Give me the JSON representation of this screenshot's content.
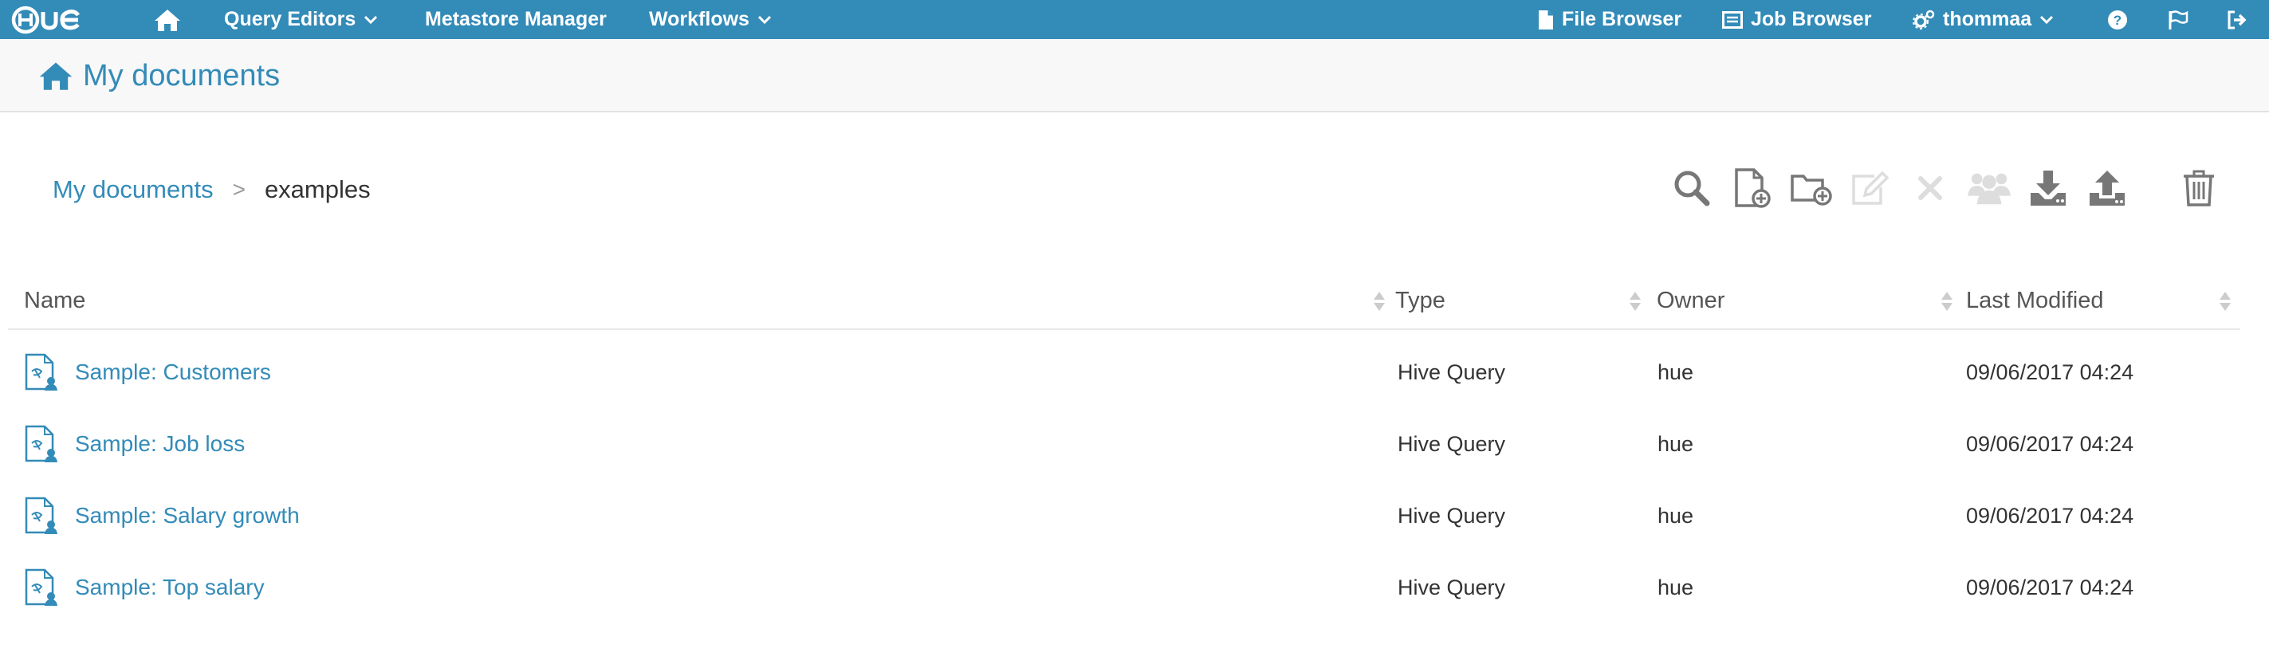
{
  "topnav": {
    "logo_text": "HUE",
    "home_icon": "home-icon",
    "query_editors": "Query Editors",
    "metastore": "Metastore Manager",
    "workflows": "Workflows",
    "file_browser": "File Browser",
    "job_browser": "Job Browser",
    "user": "thommaa",
    "help_icon": "help-icon",
    "flag_icon": "flag-icon",
    "logout_icon": "logout-icon"
  },
  "header": {
    "title": "My documents"
  },
  "breadcrumb": {
    "root": "My documents",
    "separator": ">",
    "current": "examples"
  },
  "toolbar": {
    "search_icon": "search-icon",
    "new_document_icon": "new-document-icon",
    "new_folder_icon": "new-folder-icon",
    "rename_icon": "edit-icon",
    "remove_icon": "x-icon",
    "share_icon": "users-icon",
    "download_icon": "download-icon",
    "upload_icon": "upload-icon",
    "trash_icon": "trash-icon"
  },
  "table": {
    "columns": [
      "Name",
      "Type",
      "Owner",
      "Last Modified"
    ],
    "rows": [
      {
        "name": "Sample: Customers",
        "type": "Hive Query",
        "owner": "hue",
        "modified": "09/06/2017 04:24"
      },
      {
        "name": "Sample: Job loss",
        "type": "Hive Query",
        "owner": "hue",
        "modified": "09/06/2017 04:24"
      },
      {
        "name": "Sample: Salary growth",
        "type": "Hive Query",
        "owner": "hue",
        "modified": "09/06/2017 04:24"
      },
      {
        "name": "Sample: Top salary",
        "type": "Hive Query",
        "owner": "hue",
        "modified": "09/06/2017 04:24"
      }
    ]
  },
  "colors": {
    "nav_bg": "#338bb8",
    "link": "#338bb8",
    "icon_gray": "#777777",
    "icon_disabled": "#dddddd"
  }
}
